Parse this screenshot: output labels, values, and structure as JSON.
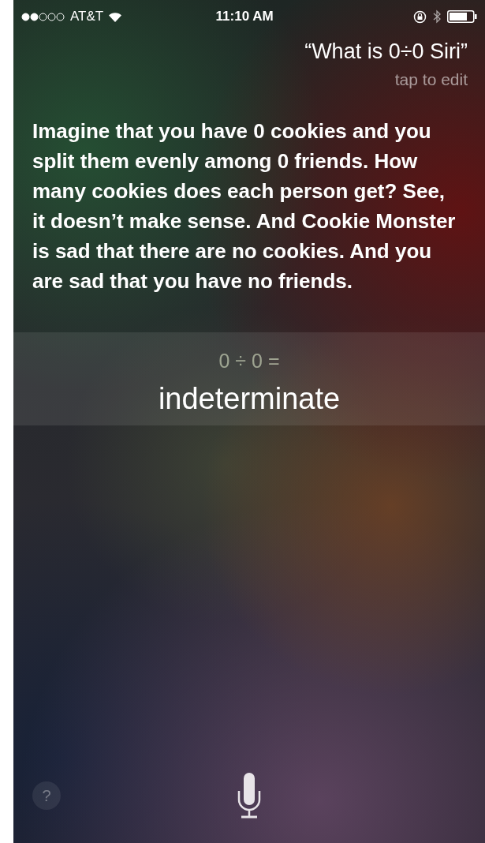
{
  "status_bar": {
    "carrier": "AT&T",
    "time": "11:10 AM"
  },
  "query": {
    "text": "“What is 0÷0 Siri”",
    "hint": "tap to edit"
  },
  "answer": {
    "text": "Imagine that you have 0 cookies and you split them evenly among 0 friends. How many cookies does each person get? See, it doesn’t make sense. And Cookie Monster is sad that there are no cookies. And you are sad that you have no friends."
  },
  "result": {
    "expression": "0 ÷ 0 =",
    "value": "indeterminate"
  },
  "help_button": {
    "label": "?"
  }
}
